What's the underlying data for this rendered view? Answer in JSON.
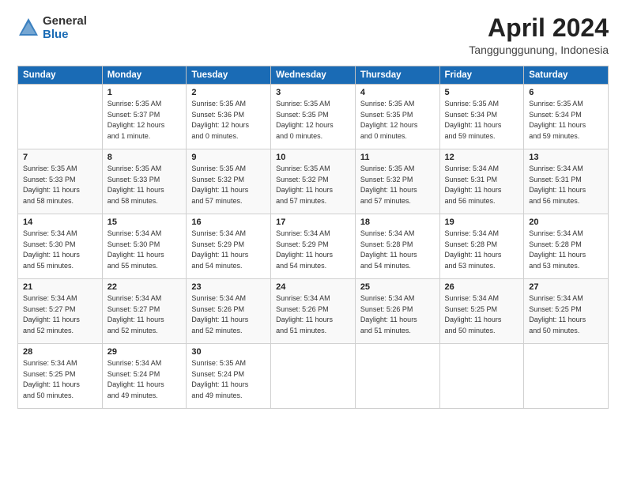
{
  "header": {
    "logo_line1": "General",
    "logo_line2": "Blue",
    "month_title": "April 2024",
    "location": "Tanggunggunung, Indonesia"
  },
  "days_of_week": [
    "Sunday",
    "Monday",
    "Tuesday",
    "Wednesday",
    "Thursday",
    "Friday",
    "Saturday"
  ],
  "weeks": [
    [
      {
        "num": "",
        "info": ""
      },
      {
        "num": "1",
        "info": "Sunrise: 5:35 AM\nSunset: 5:37 PM\nDaylight: 12 hours\nand 1 minute."
      },
      {
        "num": "2",
        "info": "Sunrise: 5:35 AM\nSunset: 5:36 PM\nDaylight: 12 hours\nand 0 minutes."
      },
      {
        "num": "3",
        "info": "Sunrise: 5:35 AM\nSunset: 5:35 PM\nDaylight: 12 hours\nand 0 minutes."
      },
      {
        "num": "4",
        "info": "Sunrise: 5:35 AM\nSunset: 5:35 PM\nDaylight: 12 hours\nand 0 minutes."
      },
      {
        "num": "5",
        "info": "Sunrise: 5:35 AM\nSunset: 5:34 PM\nDaylight: 11 hours\nand 59 minutes."
      },
      {
        "num": "6",
        "info": "Sunrise: 5:35 AM\nSunset: 5:34 PM\nDaylight: 11 hours\nand 59 minutes."
      }
    ],
    [
      {
        "num": "7",
        "info": "Sunrise: 5:35 AM\nSunset: 5:33 PM\nDaylight: 11 hours\nand 58 minutes."
      },
      {
        "num": "8",
        "info": "Sunrise: 5:35 AM\nSunset: 5:33 PM\nDaylight: 11 hours\nand 58 minutes."
      },
      {
        "num": "9",
        "info": "Sunrise: 5:35 AM\nSunset: 5:32 PM\nDaylight: 11 hours\nand 57 minutes."
      },
      {
        "num": "10",
        "info": "Sunrise: 5:35 AM\nSunset: 5:32 PM\nDaylight: 11 hours\nand 57 minutes."
      },
      {
        "num": "11",
        "info": "Sunrise: 5:35 AM\nSunset: 5:32 PM\nDaylight: 11 hours\nand 57 minutes."
      },
      {
        "num": "12",
        "info": "Sunrise: 5:34 AM\nSunset: 5:31 PM\nDaylight: 11 hours\nand 56 minutes."
      },
      {
        "num": "13",
        "info": "Sunrise: 5:34 AM\nSunset: 5:31 PM\nDaylight: 11 hours\nand 56 minutes."
      }
    ],
    [
      {
        "num": "14",
        "info": "Sunrise: 5:34 AM\nSunset: 5:30 PM\nDaylight: 11 hours\nand 55 minutes."
      },
      {
        "num": "15",
        "info": "Sunrise: 5:34 AM\nSunset: 5:30 PM\nDaylight: 11 hours\nand 55 minutes."
      },
      {
        "num": "16",
        "info": "Sunrise: 5:34 AM\nSunset: 5:29 PM\nDaylight: 11 hours\nand 54 minutes."
      },
      {
        "num": "17",
        "info": "Sunrise: 5:34 AM\nSunset: 5:29 PM\nDaylight: 11 hours\nand 54 minutes."
      },
      {
        "num": "18",
        "info": "Sunrise: 5:34 AM\nSunset: 5:28 PM\nDaylight: 11 hours\nand 54 minutes."
      },
      {
        "num": "19",
        "info": "Sunrise: 5:34 AM\nSunset: 5:28 PM\nDaylight: 11 hours\nand 53 minutes."
      },
      {
        "num": "20",
        "info": "Sunrise: 5:34 AM\nSunset: 5:28 PM\nDaylight: 11 hours\nand 53 minutes."
      }
    ],
    [
      {
        "num": "21",
        "info": "Sunrise: 5:34 AM\nSunset: 5:27 PM\nDaylight: 11 hours\nand 52 minutes."
      },
      {
        "num": "22",
        "info": "Sunrise: 5:34 AM\nSunset: 5:27 PM\nDaylight: 11 hours\nand 52 minutes."
      },
      {
        "num": "23",
        "info": "Sunrise: 5:34 AM\nSunset: 5:26 PM\nDaylight: 11 hours\nand 52 minutes."
      },
      {
        "num": "24",
        "info": "Sunrise: 5:34 AM\nSunset: 5:26 PM\nDaylight: 11 hours\nand 51 minutes."
      },
      {
        "num": "25",
        "info": "Sunrise: 5:34 AM\nSunset: 5:26 PM\nDaylight: 11 hours\nand 51 minutes."
      },
      {
        "num": "26",
        "info": "Sunrise: 5:34 AM\nSunset: 5:25 PM\nDaylight: 11 hours\nand 50 minutes."
      },
      {
        "num": "27",
        "info": "Sunrise: 5:34 AM\nSunset: 5:25 PM\nDaylight: 11 hours\nand 50 minutes."
      }
    ],
    [
      {
        "num": "28",
        "info": "Sunrise: 5:34 AM\nSunset: 5:25 PM\nDaylight: 11 hours\nand 50 minutes."
      },
      {
        "num": "29",
        "info": "Sunrise: 5:34 AM\nSunset: 5:24 PM\nDaylight: 11 hours\nand 49 minutes."
      },
      {
        "num": "30",
        "info": "Sunrise: 5:35 AM\nSunset: 5:24 PM\nDaylight: 11 hours\nand 49 minutes."
      },
      {
        "num": "",
        "info": ""
      },
      {
        "num": "",
        "info": ""
      },
      {
        "num": "",
        "info": ""
      },
      {
        "num": "",
        "info": ""
      }
    ]
  ]
}
